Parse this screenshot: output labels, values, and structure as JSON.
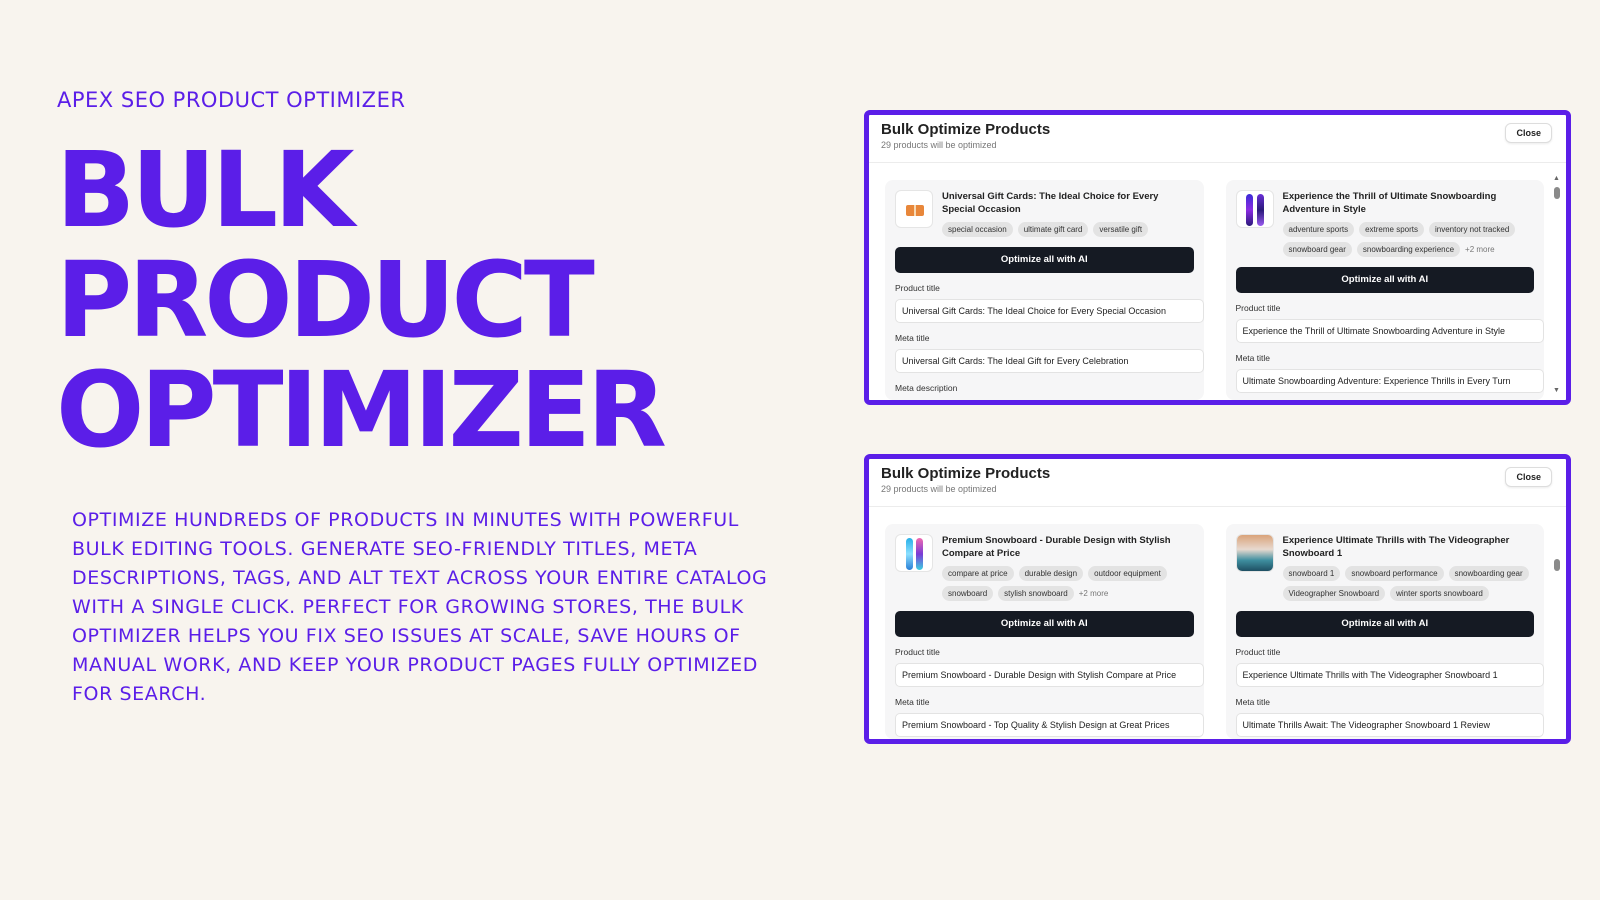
{
  "eyebrow": "APEX SEO PRODUCT OPTIMIZER",
  "hero": {
    "line1": "BULK",
    "line2": "PRODUCT",
    "line3": "OPTIMIZER"
  },
  "description": "Optimize hundreds of products in minutes with powerful bulk editing tools. Generate SEO-friendly titles, meta descriptions, tags, and alt text across your entire catalog with a single click. Perfect for growing stores, the Bulk Optimizer helps you fix SEO issues at scale, save hours of manual work, and keep your product pages fully optimized for search.",
  "colors": {
    "accent": "#5b1ee8",
    "background": "#f8f4ee",
    "button_dark": "#151a23"
  },
  "screens": [
    {
      "modal_title": "Bulk Optimize Products",
      "modal_sub": "29 products will be optimized",
      "close_label": "Close",
      "cards": [
        {
          "thumb_icon": "gift-card-icon",
          "name": "Universal Gift Cards: The Ideal Choice for Every Special Occasion",
          "tags": [
            "special occasion",
            "ultimate gift card",
            "versatile gift"
          ],
          "more": "",
          "button": "Optimize all with AI",
          "product_title_label": "Product title",
          "product_title_value": "Universal Gift Cards: The Ideal Choice for Every Special Occasion",
          "meta_title_label": "Meta title",
          "meta_title_value": "Universal Gift Cards: The Ideal Gift for Every Celebration",
          "meta_desc_label": "Meta description"
        },
        {
          "thumb_icon": "snowboard-icon",
          "name": "Experience the Thrill of Ultimate Snowboarding Adventure in Style",
          "tags": [
            "adventure sports",
            "extreme sports",
            "inventory not tracked",
            "snowboard gear",
            "snowboarding experience"
          ],
          "more": "+2 more",
          "button": "Optimize all with AI",
          "product_title_label": "Product title",
          "product_title_value": "Experience the Thrill of Ultimate Snowboarding Adventure in Style",
          "meta_title_label": "Meta title",
          "meta_title_value": "Ultimate Snowboarding Adventure: Experience Thrills in Every Turn"
        }
      ]
    },
    {
      "modal_title": "Bulk Optimize Products",
      "modal_sub": "29 products will be optimized",
      "close_label": "Close",
      "cards": [
        {
          "thumb_icon": "snowboard-icon",
          "name": "Premium Snowboard - Durable Design with Stylish Compare at Price",
          "tags": [
            "compare at price",
            "durable design",
            "outdoor equipment",
            "snowboard",
            "stylish snowboard"
          ],
          "more": "+2 more",
          "button": "Optimize all with AI",
          "product_title_label": "Product title",
          "product_title_value": "Premium Snowboard - Durable Design with Stylish Compare at Price",
          "meta_title_label": "Meta title",
          "meta_title_value": "Premium Snowboard - Top Quality & Stylish Design at Great Prices"
        },
        {
          "thumb_icon": "snowboard-photo-icon",
          "name": "Experience Ultimate Thrills with The Videographer Snowboard 1",
          "tags": [
            "snowboard 1",
            "snowboard performance",
            "snowboarding gear",
            "Videographer Snowboard",
            "winter sports snowboard"
          ],
          "more": "",
          "button": "Optimize all with AI",
          "product_title_label": "Product title",
          "product_title_value": "Experience Ultimate Thrills with The Videographer Snowboard 1",
          "meta_title_label": "Meta title",
          "meta_title_value": "Ultimate Thrills Await: The Videographer Snowboard 1 Review"
        }
      ]
    }
  ]
}
